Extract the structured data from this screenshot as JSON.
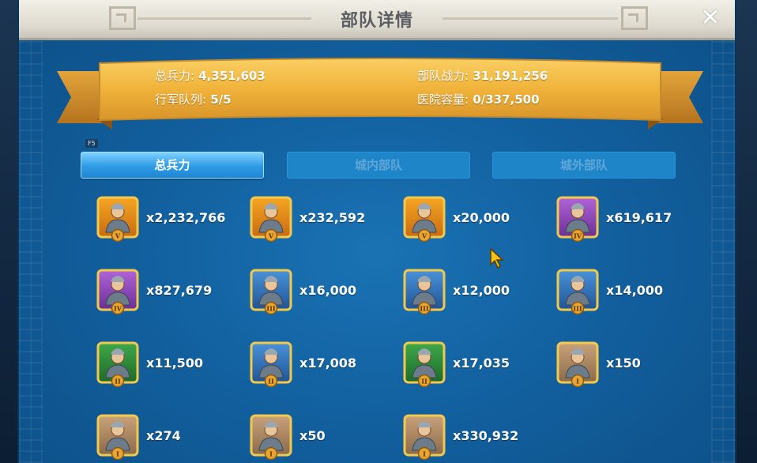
{
  "window": {
    "title": "部队详情"
  },
  "summary": {
    "total_troops_label": "总兵力:",
    "total_troops_value": "4,351,603",
    "troop_power_label": "部队战力:",
    "troop_power_value": "31,191,256",
    "march_queue_label": "行军队列:",
    "march_queue_value": "5/5",
    "hospital_label": "医院容量:",
    "hospital_value": "0/337,500"
  },
  "hotkey_badge": "F5",
  "tabs": [
    {
      "label": "总兵力",
      "active": true
    },
    {
      "label": "城内部队",
      "active": false
    },
    {
      "label": "城外部队",
      "active": false
    }
  ],
  "units": [
    {
      "count": "x2,232,766",
      "tier": "V",
      "icon": "cavalry-tier5-icon",
      "theme": "orange"
    },
    {
      "count": "x232,592",
      "tier": "V",
      "icon": "siege-tier5-icon",
      "theme": "orange"
    },
    {
      "count": "x20,000",
      "tier": "V",
      "icon": "archer-tier5-icon",
      "theme": "orange"
    },
    {
      "count": "x619,617",
      "tier": "IV",
      "icon": "infantry-tier4-icon",
      "theme": "purple"
    },
    {
      "count": "x827,679",
      "tier": "IV",
      "icon": "archer-tier4-icon",
      "theme": "purple"
    },
    {
      "count": "x16,000",
      "tier": "III",
      "icon": "infantry-tier3-icon",
      "theme": "blue"
    },
    {
      "count": "x12,000",
      "tier": "III",
      "icon": "cavalry-tier3-icon",
      "theme": "blue"
    },
    {
      "count": "x14,000",
      "tier": "III",
      "icon": "archer-tier3-icon",
      "theme": "blue"
    },
    {
      "count": "x11,500",
      "tier": "II",
      "icon": "infantry-tier2-icon",
      "theme": "green"
    },
    {
      "count": "x17,008",
      "tier": "II",
      "icon": "cavalry-tier2-icon",
      "theme": "blue"
    },
    {
      "count": "x17,035",
      "tier": "II",
      "icon": "archer-tier2-icon",
      "theme": "green"
    },
    {
      "count": "x150",
      "tier": "I",
      "icon": "infantry-tier1-icon",
      "theme": "gray"
    },
    {
      "count": "x274",
      "tier": "I",
      "icon": "cavalry-tier1-icon",
      "theme": "gray"
    },
    {
      "count": "x50",
      "tier": "I",
      "icon": "archer-tier1-icon",
      "theme": "gray"
    },
    {
      "count": "x330,932",
      "tier": "I",
      "icon": "siege-tier1-icon",
      "theme": "gray"
    }
  ],
  "colors": {
    "banner_gold": "#f1b73d",
    "panel_blue": "#12609f",
    "tab_active": "#2f9be6",
    "tab_inactive": "#1f85c9"
  }
}
